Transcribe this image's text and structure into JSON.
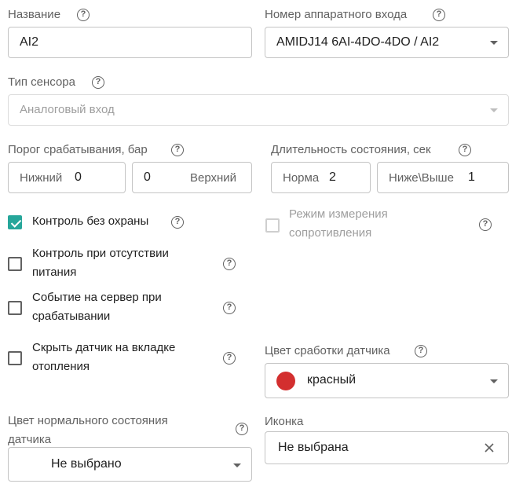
{
  "name_field": {
    "label": "Название",
    "value": "AI2"
  },
  "hw_input": {
    "label": "Номер аппаратного входа",
    "value": "AMIDJ14 6AI-4DO-4DO / AI2"
  },
  "sensor_type": {
    "label": "Тип сенсора",
    "value": "Аналоговый вход"
  },
  "threshold": {
    "label": "Порог срабатывания, бар",
    "lower_label": "Нижний",
    "lower_value": "0",
    "upper_value": "0",
    "upper_label": "Верхний"
  },
  "duration": {
    "label": "Длительность состояния, сек",
    "normal_label": "Норма",
    "normal_value": "2",
    "below_above_label": "Ниже\\Выше",
    "below_above_value": "1"
  },
  "checkboxes": {
    "no_guard": {
      "line1": "Контроль без охраны",
      "checked": true
    },
    "resistance": {
      "line1": "Режим измерения",
      "line2": "сопротивления",
      "checked": false,
      "disabled": true
    },
    "power_loss": {
      "line1": "Контроль при отсутствии",
      "line2": "питания",
      "checked": false
    },
    "server_event": {
      "line1": "Событие на сервер при",
      "line2": "срабатывании",
      "checked": false
    },
    "hide_heating": {
      "line1": "Скрыть датчик на вкладке",
      "line2": "отопления",
      "checked": false
    }
  },
  "trigger_color": {
    "label": "Цвет сработки датчика",
    "value": "красный",
    "swatch": "#d32f2f"
  },
  "normal_color": {
    "label_line1": "Цвет нормального состояния",
    "label_line2": "датчика",
    "value": "Не выбрано"
  },
  "icon_field": {
    "label": "Иконка",
    "value": "Не выбрана"
  },
  "help_glyph": "?",
  "accent_color": "#26a69a"
}
